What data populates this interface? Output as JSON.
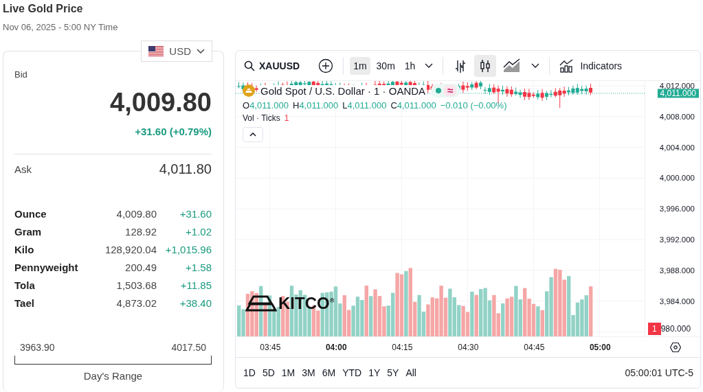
{
  "header": {
    "title": "Live Gold Price",
    "subtitle": "Nov 06, 2025 - 5:00 NY Time"
  },
  "currency": {
    "label": "USD"
  },
  "bid": {
    "label": "Bid",
    "value": "4,009.80",
    "change": "+31.60 (+0.79%)"
  },
  "ask": {
    "label": "Ask",
    "value": "4,011.80"
  },
  "units": [
    {
      "name": "Ounce",
      "price": "4,009.80",
      "change": "+31.60"
    },
    {
      "name": "Gram",
      "price": "128.92",
      "change": "+1.02"
    },
    {
      "name": "Kilo",
      "price": "128,920.04",
      "change": "+1,015.96"
    },
    {
      "name": "Pennyweight",
      "price": "200.49",
      "change": "+1.58"
    },
    {
      "name": "Tola",
      "price": "1,503.68",
      "change": "+11.85"
    },
    {
      "name": "Tael",
      "price": "4,873.02",
      "change": "+38.40"
    }
  ],
  "days_range": {
    "low": "3963.90",
    "high": "4017.50",
    "label": "Day's Range"
  },
  "chart": {
    "toolbar": {
      "symbol": "XAUUSD",
      "intervals": [
        {
          "label": "1m",
          "selected": true
        },
        {
          "label": "30m",
          "selected": false
        },
        {
          "label": "1h",
          "selected": false
        }
      ],
      "chart_types": [
        {
          "kind": "bars",
          "selected": false
        },
        {
          "kind": "candles",
          "selected": true
        },
        {
          "kind": "area",
          "selected": false
        }
      ],
      "indicators": "Indicators"
    },
    "legend": {
      "title": "Gold Spot / U.S. Dollar · 1 · OANDA",
      "ohlc": [
        {
          "label": "O",
          "value": "4,011.000"
        },
        {
          "label": "H",
          "value": "4,011.000"
        },
        {
          "label": "L",
          "value": "4,011.000"
        },
        {
          "label": "C",
          "value": "4,011.000"
        }
      ],
      "change": "−0.010 (−0.00%)",
      "badge": "≈",
      "volume_label": "Vol · Ticks",
      "volume_value": "1"
    },
    "logo": "KITCO$^{®}$",
    "price_axis": [
      "4,012.000",
      "4,008.000",
      "4,004.000",
      "4,000.000",
      "3,996.000",
      "3,992.000",
      "3,988.000",
      "3,984.000"
    ],
    "last_price": "4,011.000",
    "time_axis": [
      {
        "label": "03:45",
        "major": false
      },
      {
        "label": "04:00",
        "major": true
      },
      {
        "label": "04:15",
        "major": false
      },
      {
        "label": "04:30",
        "major": false
      },
      {
        "label": "04:45",
        "major": false
      },
      {
        "label": "05:00",
        "major": true
      }
    ],
    "volume_badge": "1",
    "bottom_price": "980.000",
    "ranges": [
      "1D",
      "5D",
      "1M",
      "3M",
      "6M",
      "YTD",
      "1Y",
      "5Y",
      "All"
    ],
    "clock": "05:00:01 UTC-5"
  }
}
